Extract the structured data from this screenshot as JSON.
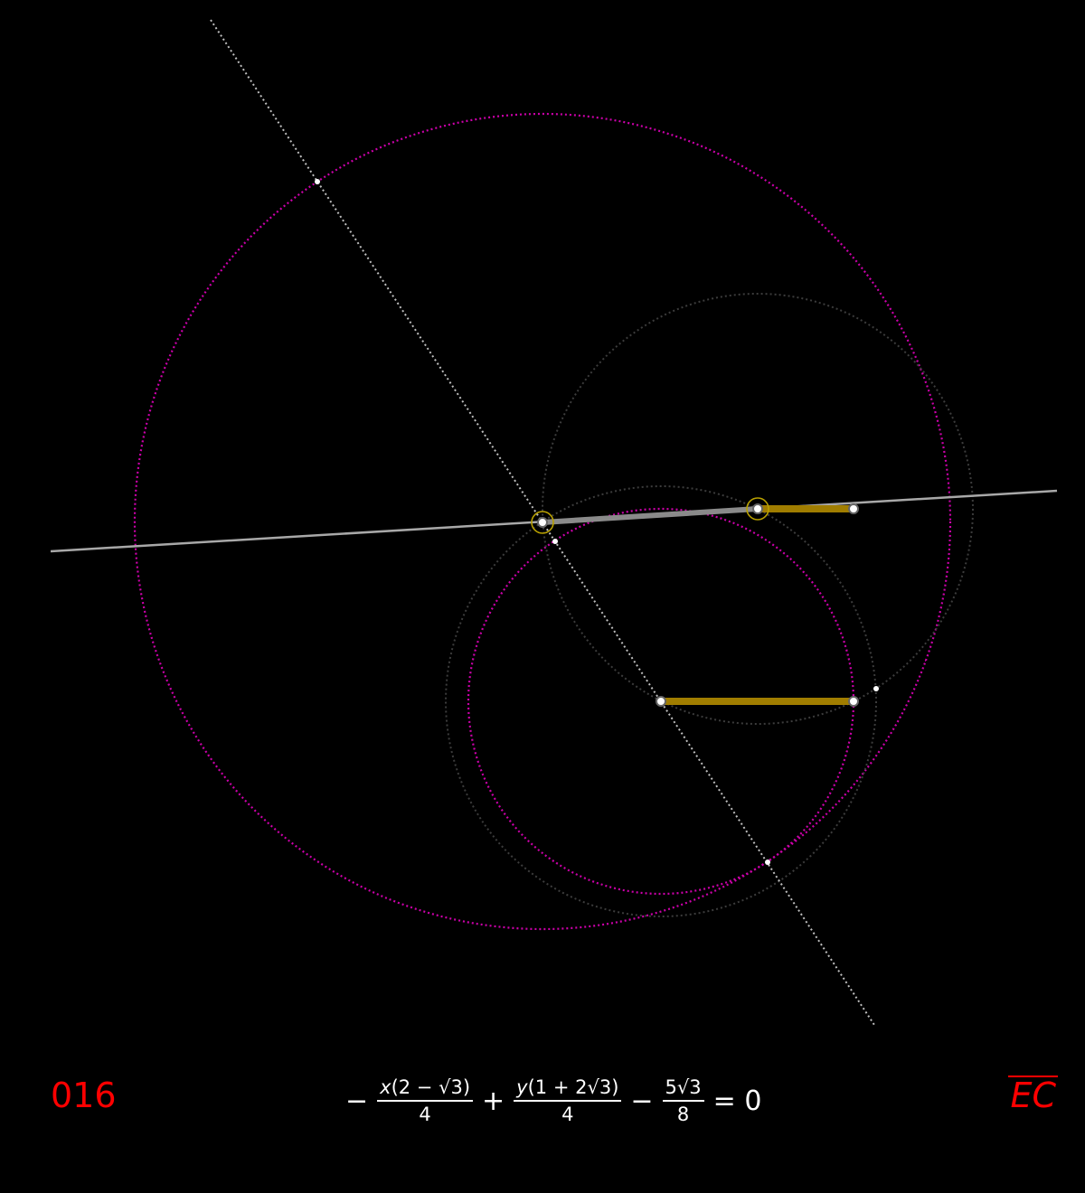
{
  "figure_number": "016",
  "segment_label": "EC",
  "equation": {
    "lead_minus": "−",
    "term1_num_var": "x",
    "term1_num_rest": "(2 − √3)",
    "term1_den": "4",
    "plus": "+",
    "term2_num_var": "y",
    "term2_num_rest": "(1 + 2√3)",
    "term2_den": "4",
    "minus": "−",
    "term3_num": "5√3",
    "term3_den": "8",
    "equals": "= 0"
  },
  "colors": {
    "background": "#000000",
    "magenta_circle": "#cc00aa",
    "gray_circle": "#3a3a3a",
    "line": "#b0b0b0",
    "segment": "#a07d00",
    "highlight_ring": "#b8a000",
    "point": "#ffffff",
    "label": "#ff0000"
  }
}
